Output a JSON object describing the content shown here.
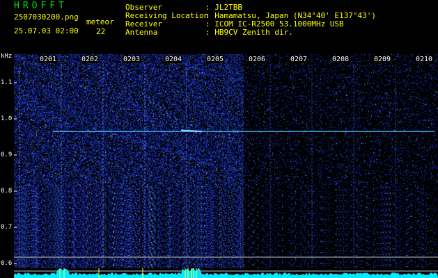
{
  "header": {
    "logo": "HROFFT",
    "filename": "2507030200.png",
    "datetime": "25.07.03 02:00",
    "meteor_label": "meteor",
    "meteor_count": "22",
    "fields": [
      {
        "label": "Observer",
        "value": ": JL2TBB"
      },
      {
        "label": "Receiving Location",
        "value": ": Hamamatsu, Japan (N34°40' E137°43')"
      },
      {
        "label": "Receiver",
        "value": ": ICOM IC-R2500 53.1000MHz USB"
      },
      {
        "label": "Antenna",
        "value": ": HB9CV Zenith dir."
      }
    ]
  },
  "axis": {
    "unit": "kHz",
    "y_ticks": [
      {
        "label": "1.1",
        "value": 1.1
      },
      {
        "label": "1.0",
        "value": 1.0
      },
      {
        "label": "0.9",
        "value": 0.9
      },
      {
        "label": "0.8",
        "value": 0.8
      },
      {
        "label": "0.7",
        "value": 0.7
      },
      {
        "label": "0.6",
        "value": 0.6
      }
    ],
    "y_range": [
      0.575,
      1.175
    ],
    "time_labels": [
      "0201",
      "0202",
      "0203",
      "0204",
      "0205",
      "0206",
      "0207",
      "0208",
      "0209",
      "0210"
    ]
  },
  "colors": {
    "background": "#000000",
    "header_text": "#ffff00",
    "value_text": "#ffffff",
    "logo": "#00e000",
    "noise": "#1020c0",
    "carrier": "#40c0ff",
    "level_bar": "#00e8ff"
  },
  "carrier_khz": 0.965
}
